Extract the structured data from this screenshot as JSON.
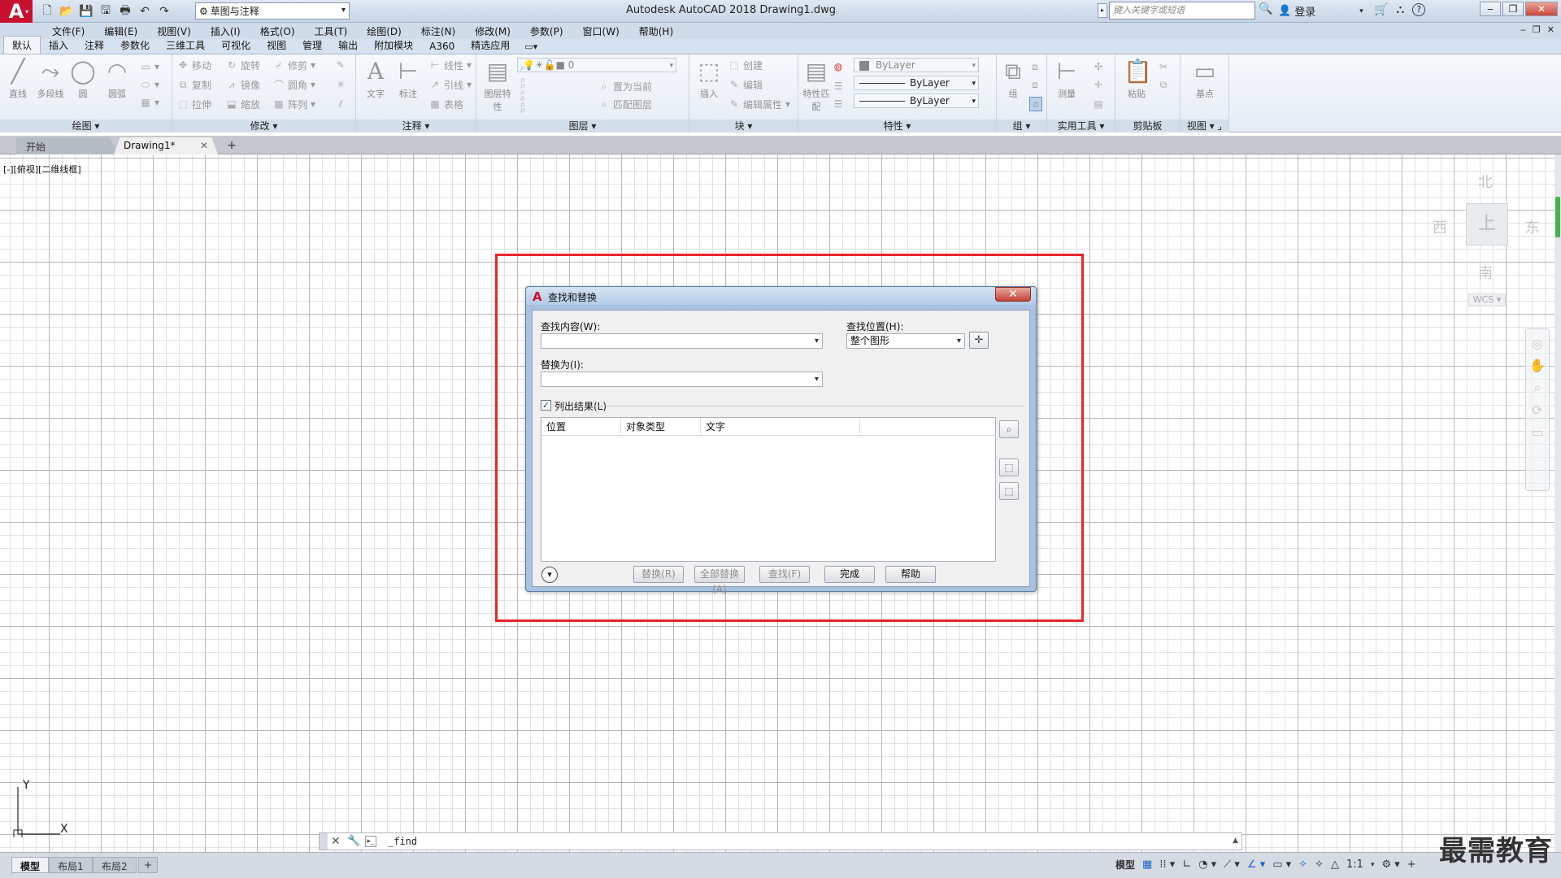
{
  "titlebar": {
    "app_logo": "A",
    "workspace": "草图与注释",
    "window_title": "Autodesk AutoCAD 2018    Drawing1.dwg",
    "search_placeholder": "键入关键字或短语",
    "login": "登录",
    "help": "?"
  },
  "menubar": {
    "items": [
      "文件(F)",
      "编辑(E)",
      "视图(V)",
      "插入(I)",
      "格式(O)",
      "工具(T)",
      "绘图(D)",
      "标注(N)",
      "修改(M)",
      "参数(P)",
      "窗口(W)",
      "帮助(H)"
    ]
  },
  "ribbon_tabs": [
    "默认",
    "插入",
    "注释",
    "参数化",
    "三维工具",
    "可视化",
    "视图",
    "管理",
    "输出",
    "附加模块",
    "A360",
    "精选应用"
  ],
  "ribbon": {
    "draw": {
      "title": "绘图",
      "tools": [
        "直线",
        "多段线",
        "圆",
        "圆弧"
      ]
    },
    "modify": {
      "title": "修改",
      "tools": [
        "移动",
        "旋转",
        "修剪",
        "复制",
        "镜像",
        "圆角",
        "拉伸",
        "缩放",
        "阵列"
      ]
    },
    "annotation": {
      "title": "注释",
      "tools": [
        "文字",
        "标注",
        "线性",
        "引线",
        "表格"
      ]
    },
    "layers": {
      "title": "图层",
      "tools": [
        "图层特性",
        "置为当前",
        "匹配图层"
      ],
      "current_layer": "0"
    },
    "block": {
      "title": "块",
      "tools": [
        "插入",
        "创建",
        "编辑",
        "编辑属性"
      ]
    },
    "properties": {
      "title": "特性",
      "tools": [
        "特性匹配"
      ],
      "color": "ByLayer",
      "linetype": "ByLayer",
      "lineweight": "ByLayer"
    },
    "groups": {
      "title": "组",
      "tools": [
        "组"
      ]
    },
    "utilities": {
      "title": "实用工具",
      "tools": [
        "测量"
      ]
    },
    "clipboard": {
      "title": "剪贴板",
      "tools": [
        "粘贴"
      ]
    },
    "view": {
      "title": "视图",
      "tools": [
        "基点"
      ]
    }
  },
  "doc_tabs": {
    "start": "开始",
    "drawing": "Drawing1*",
    "new": "+"
  },
  "viewport_label": "[-][俯视][二维线框]",
  "viewcube": {
    "north": "北",
    "south": "南",
    "east": "东",
    "west": "西",
    "top": "上",
    "wcs": "WCS"
  },
  "dialog": {
    "title": "查找和替换",
    "find_label": "查找内容(W):",
    "find_value": "",
    "replace_label": "替换为(I):",
    "replace_value": "",
    "location_label": "查找位置(H):",
    "location_value": "整个图形",
    "list_results_label": "列出结果(L)",
    "list_results_checked": true,
    "columns": [
      "位置",
      "对象类型",
      "文字"
    ],
    "buttons": {
      "replace": "替换(R)",
      "replace_all": "全部替换(A)",
      "find": "查找(F)",
      "done": "完成",
      "help": "帮助"
    }
  },
  "ucs": {
    "x": "X",
    "y": "Y"
  },
  "command_line": {
    "text": "_find"
  },
  "statusbar": {
    "layout_tabs": [
      "模型",
      "布局1",
      "布局2"
    ],
    "model_label": "模型",
    "scale": "1:1"
  },
  "watermark": "最需教育",
  "colors": {
    "highlight": "#e8262a",
    "app_red": "#c8102e"
  }
}
